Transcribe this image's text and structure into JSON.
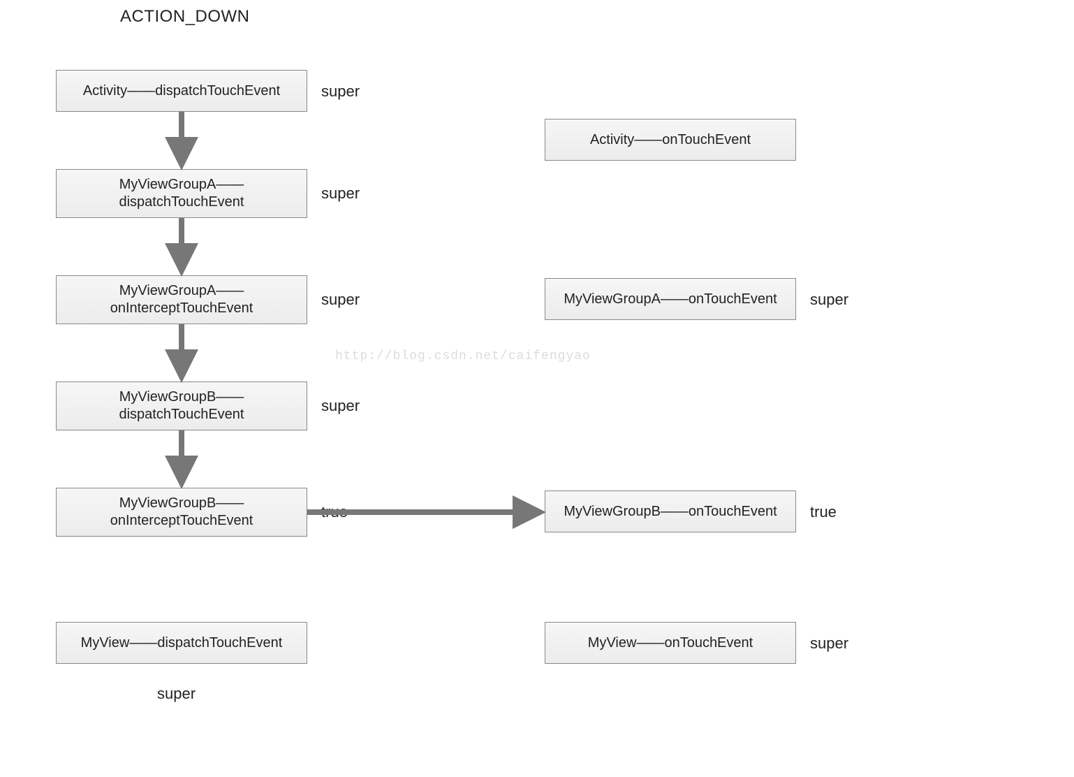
{
  "title": "ACTION_DOWN",
  "watermark": "http://blog.csdn.net/caifengyao",
  "left_boxes": {
    "b1": "Activity——dispatchTouchEvent",
    "b2": "MyViewGroupA——\ndispatchTouchEvent",
    "b3": "MyViewGroupA——\nonInterceptTouchEvent",
    "b4": "MyViewGroupB——\ndispatchTouchEvent",
    "b5": "MyViewGroupB——\nonInterceptTouchEvent",
    "b6": "MyView——dispatchTouchEvent"
  },
  "right_boxes": {
    "r1": "Activity——onTouchEvent",
    "r2": "MyViewGroupA——onTouchEvent",
    "r3": "MyViewGroupB——onTouchEvent",
    "r4": "MyView——onTouchEvent"
  },
  "left_labels": {
    "l1": "super",
    "l2": "super",
    "l3": "super",
    "l4": "super",
    "l5": "true",
    "l6": "super"
  },
  "right_labels": {
    "rl2": "super",
    "rl3": "true",
    "rl4": "super"
  }
}
